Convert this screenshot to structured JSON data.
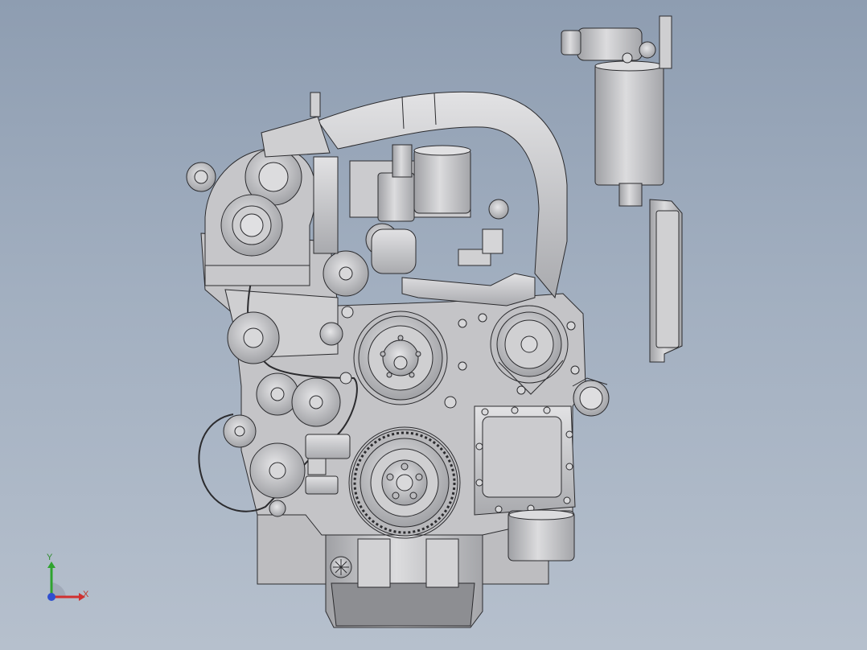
{
  "viewport": {
    "background_top": "#8e9db1",
    "background_bottom": "#b6c0cd",
    "model_color": "#c9c9cb",
    "model_shadow": "#8f9094",
    "edge_color": "#2b2b2e"
  },
  "triad": {
    "x_label": "X",
    "y_label": "Y",
    "x_color": "#d03030",
    "y_color": "#2fa32f",
    "z_color": "#2f4fd0"
  },
  "model": {
    "name": "engine-assembly-front-view",
    "components": [
      "fuel-filter",
      "intake-pipe",
      "turbocharger",
      "water-pump-pulley",
      "crankshaft-pulley",
      "alternator",
      "timing-cover",
      "oil-pan",
      "side-cover-plate"
    ]
  }
}
